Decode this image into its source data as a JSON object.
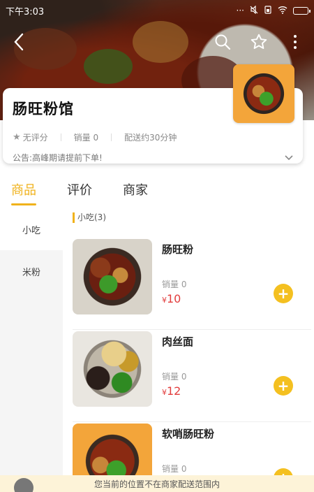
{
  "status_bar": {
    "time": "下午3:03",
    "icons": [
      "more-dots-icon",
      "mute-icon",
      "sim-icon",
      "wifi-icon",
      "battery-icon"
    ]
  },
  "top_bar": {
    "icons": [
      "back-icon",
      "search-icon",
      "star-icon",
      "more-vertical-icon"
    ]
  },
  "shop": {
    "name": "肠旺粉馆",
    "rating_label": "无评分",
    "sales_label": "销量 0",
    "delivery_label": "配送约30分钟",
    "notice": "公告:高峰期请提前下单!"
  },
  "tabs": [
    {
      "label": "商品",
      "active": true
    },
    {
      "label": "评价",
      "active": false
    },
    {
      "label": "商家",
      "active": false
    }
  ],
  "categories": [
    {
      "label": "小吃",
      "active": true
    },
    {
      "label": "米粉",
      "active": false
    }
  ],
  "section_title": "小吃(3)",
  "products": [
    {
      "name": "肠旺粉",
      "sales": "销量 0",
      "currency": "¥",
      "price": "10",
      "image": "food-noodle"
    },
    {
      "name": "肉丝面",
      "sales": "销量 0",
      "currency": "¥",
      "price": "12",
      "image": "food-mixed"
    },
    {
      "name": "软哨肠旺粉",
      "sales": "销量 0",
      "currency": "",
      "price": "",
      "image": "food-tripe"
    }
  ],
  "bottom_notice": "您当前的位置不在商家配送范围内",
  "colors": {
    "accent": "#f0b21b",
    "price": "#e23d3d",
    "add_button": "#f4c020",
    "notice_bg": "#fdf3d8"
  }
}
